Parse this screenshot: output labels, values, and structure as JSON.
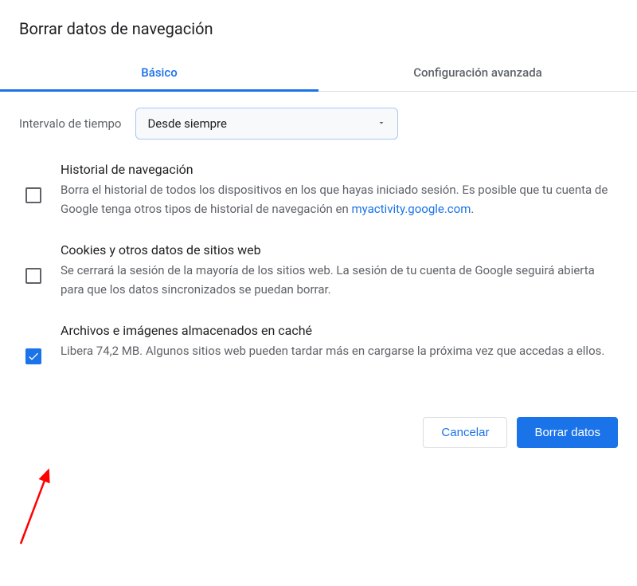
{
  "dialog": {
    "title": "Borrar datos de navegación"
  },
  "tabs": {
    "basic": "Básico",
    "advanced": "Configuración avanzada"
  },
  "timeRange": {
    "label": "Intervalo de tiempo",
    "selected": "Desde siempre"
  },
  "options": {
    "history": {
      "title": "Historial de navegación",
      "desc_part1": "Borra el historial de todos los dispositivos en los que hayas iniciado sesión. Es posible que tu cuenta de Google tenga otros tipos de historial de navegación en ",
      "link": "myactivity.google.com",
      "desc_part2": ".",
      "checked": false
    },
    "cookies": {
      "title": "Cookies y otros datos de sitios web",
      "desc": "Se cerrará la sesión de la mayoría de los sitios web. La sesión de tu cuenta de Google seguirá abierta para que los datos sincronizados se puedan borrar.",
      "checked": false
    },
    "cache": {
      "title": "Archivos e imágenes almacenados en caché",
      "desc": "Libera 74,2 MB. Algunos sitios web pueden tardar más en cargarse la próxima vez que accedas a ellos.",
      "checked": true
    }
  },
  "buttons": {
    "cancel": "Cancelar",
    "clear": "Borrar datos"
  }
}
